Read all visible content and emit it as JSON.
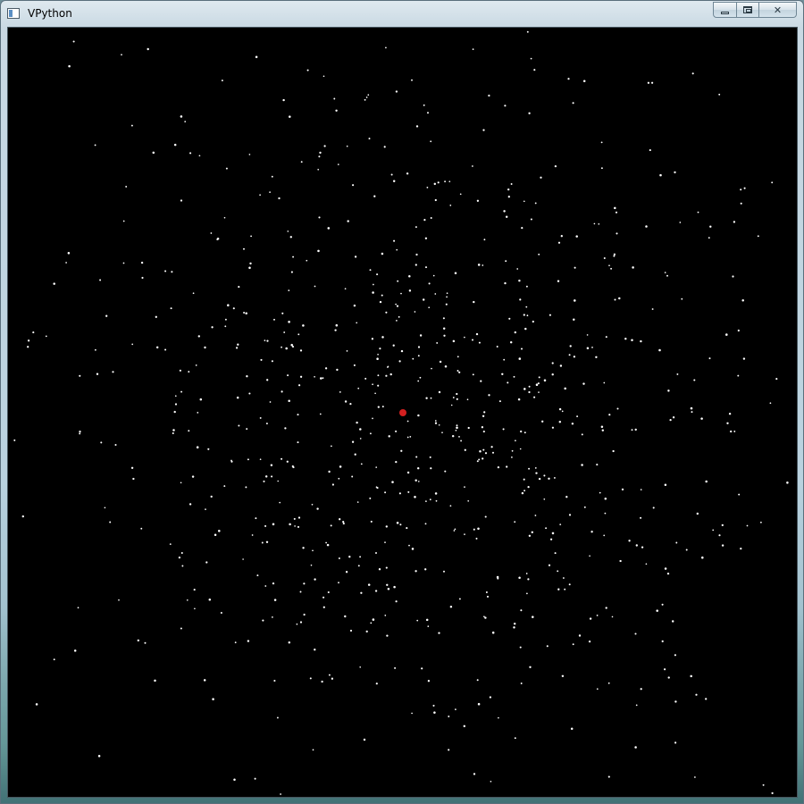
{
  "window": {
    "title": "VPython",
    "icon": "app-window-icon",
    "controls": {
      "minimize_icon": "minimize-icon",
      "maximize_icon": "maximize-icon",
      "close_label": "✕"
    }
  },
  "scene": {
    "background": "#000000",
    "particle_color": "#ffffff",
    "center_object_color": "#d42020",
    "particle_count": 900
  }
}
